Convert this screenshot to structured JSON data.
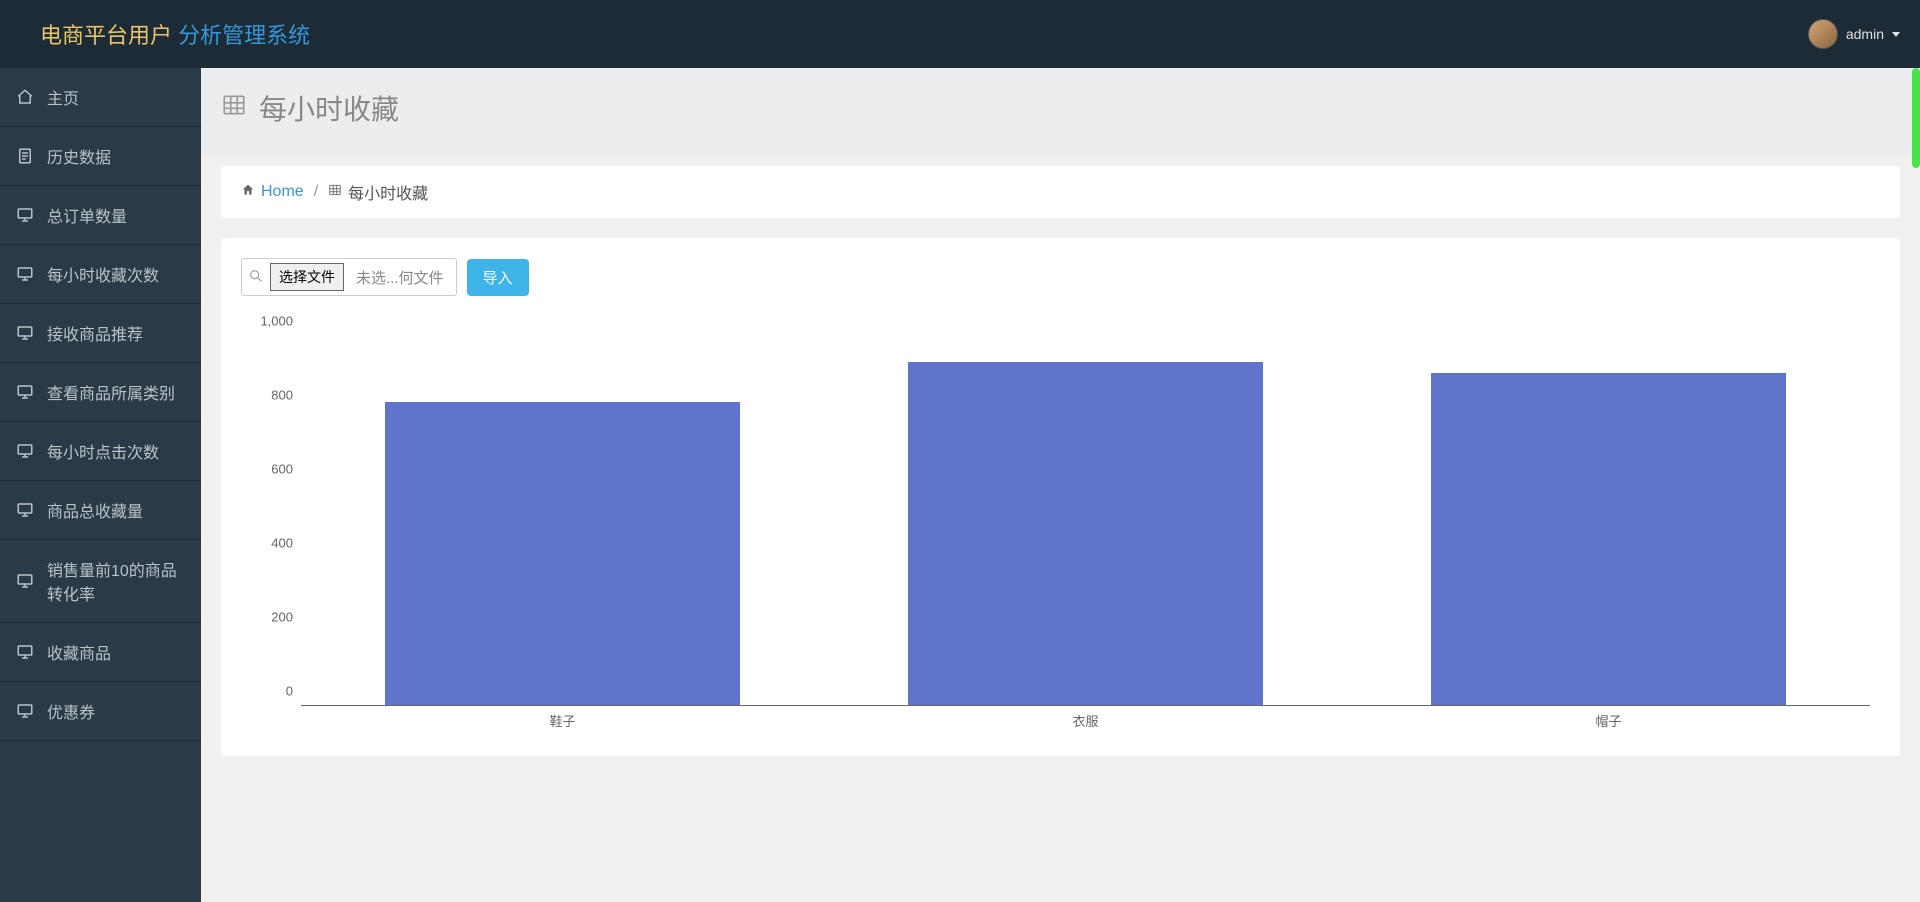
{
  "header": {
    "brand_a": "电商平台用户",
    "brand_b": "分析管理系统",
    "username": "admin"
  },
  "sidebar": {
    "items": [
      {
        "label": "主页",
        "icon": "home"
      },
      {
        "label": "历史数据",
        "icon": "doc"
      },
      {
        "label": "总订单数量",
        "icon": "monitor"
      },
      {
        "label": "每小时收藏次数",
        "icon": "monitor"
      },
      {
        "label": "接收商品推荐",
        "icon": "monitor"
      },
      {
        "label": "查看商品所属类别",
        "icon": "monitor"
      },
      {
        "label": "每小时点击次数",
        "icon": "monitor"
      },
      {
        "label": "商品总收藏量",
        "icon": "monitor"
      },
      {
        "label": "销售量前10的商品转化率",
        "icon": "monitor"
      },
      {
        "label": "收藏商品",
        "icon": "monitor"
      },
      {
        "label": "优惠券",
        "icon": "monitor"
      }
    ]
  },
  "page": {
    "title": "每小时收藏",
    "breadcrumb_home": "Home",
    "breadcrumb_current": "每小时收藏"
  },
  "toolbar": {
    "file_button": "选择文件",
    "file_status": "未选...何文件",
    "import_button": "导入"
  },
  "chart_data": {
    "type": "bar",
    "categories": [
      "鞋子",
      "衣服",
      "帽子"
    ],
    "values": [
      820,
      930,
      900
    ],
    "title": "",
    "xlabel": "",
    "ylabel": "",
    "ylim": [
      0,
      1000
    ],
    "y_ticks": [
      0,
      200,
      400,
      600,
      800,
      1000
    ],
    "y_tick_labels": [
      "0",
      "200",
      "400",
      "600",
      "800",
      "1,000"
    ]
  }
}
